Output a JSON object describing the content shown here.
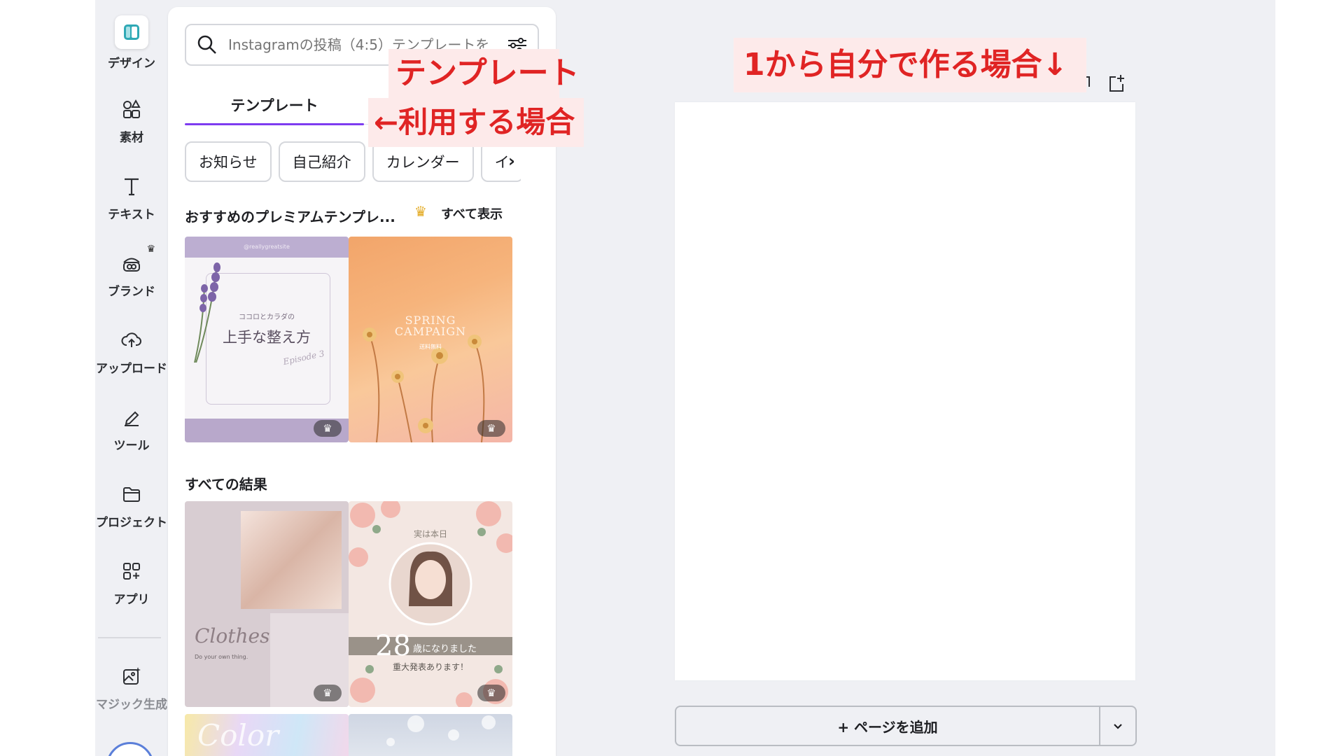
{
  "rail": {
    "items": [
      {
        "label": "デザイン",
        "icon": "design-icon"
      },
      {
        "label": "素材",
        "icon": "elements-icon"
      },
      {
        "label": "テキスト",
        "icon": "text-icon"
      },
      {
        "label": "ブランド",
        "icon": "brand-icon"
      },
      {
        "label": "アップロード",
        "icon": "upload-icon"
      },
      {
        "label": "ツール",
        "icon": "tools-icon"
      },
      {
        "label": "プロジェクト",
        "icon": "folder-icon"
      },
      {
        "label": "アプリ",
        "icon": "apps-icon"
      },
      {
        "label": "マジック生成",
        "icon": "magic-media-icon"
      }
    ],
    "brand_crown": "♛"
  },
  "panel": {
    "search": {
      "placeholder": "Instagramの投稿（4:5）テンプレートを"
    },
    "tabs": [
      {
        "label": "テンプレート"
      }
    ],
    "chips": [
      "お知らせ",
      "自己紹介",
      "カレンダー",
      "イ"
    ],
    "chip_arrow": "›",
    "premium": {
      "title": "おすすめのプレミアムテンプレ...",
      "see_all": "すべて表示",
      "crown": "♛"
    },
    "all_results": {
      "title": "すべての結果"
    },
    "templates": {
      "t1": {
        "handle": "@reallygreatsite",
        "small": "ココロとカラダの",
        "main": "上手な整え方",
        "script": "Episode 3"
      },
      "t2": {
        "title_line1": "SPRING",
        "title_line2": "CAMPAIGN",
        "sub": "送料無料"
      },
      "t3": {
        "script": "Clothes",
        "tagline": "Do your own thing."
      },
      "t4": {
        "top": "実は本日",
        "number": "28",
        "caption": "歳になりました",
        "sub": "重大発表あります！"
      },
      "t5": {
        "script": "Color"
      }
    },
    "pro_badge": "♛"
  },
  "canvas": {
    "add_page": "+ ページを追加"
  },
  "annotations": {
    "template_line1": "テンプレート",
    "template_line2": "←利用する場合",
    "scratch": "1から自分で作る場合↓"
  },
  "colors": {
    "accent": "#7d3cf0",
    "annotation": "#e02424",
    "annotation_bg": "#fdeaea",
    "crown": "#e3a91f"
  }
}
